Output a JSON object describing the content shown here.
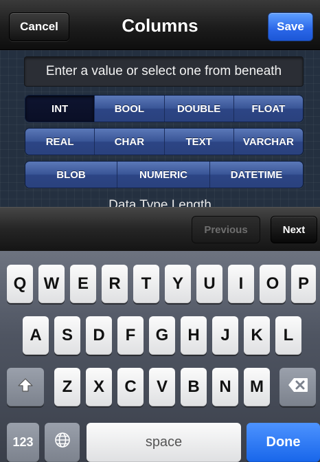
{
  "navbar": {
    "cancel_label": "Cancel",
    "title": "Columns",
    "save_label": "Save"
  },
  "value_field": {
    "placeholder": "Enter a value or select one from beneath"
  },
  "data_types": {
    "row1": [
      "INT",
      "BOOL",
      "DOUBLE",
      "FLOAT"
    ],
    "row2": [
      "REAL",
      "CHAR",
      "TEXT",
      "VARCHAR"
    ],
    "row3": [
      "BLOB",
      "NUMERIC",
      "DATETIME"
    ],
    "selected": "INT"
  },
  "length_label": "Data Type Length",
  "accessory": {
    "previous_label": "Previous",
    "next_label": "Next"
  },
  "keyboard": {
    "row1": [
      "Q",
      "W",
      "E",
      "R",
      "T",
      "Y",
      "U",
      "I",
      "O",
      "P"
    ],
    "row2": [
      "A",
      "S",
      "D",
      "F",
      "G",
      "H",
      "J",
      "K",
      "L"
    ],
    "row3": [
      "Z",
      "X",
      "C",
      "V",
      "B",
      "N",
      "M"
    ],
    "numbers_label": "123",
    "space_label": "space",
    "done_label": "Done",
    "shift_icon": "shift-arrow-icon",
    "globe_icon": "globe-icon",
    "backspace_icon": "backspace-icon"
  },
  "colors": {
    "save_button": "#2a66e8",
    "done_key": "#1866ea",
    "segment": "#3a5697",
    "segment_selected": "#0a0f26"
  }
}
